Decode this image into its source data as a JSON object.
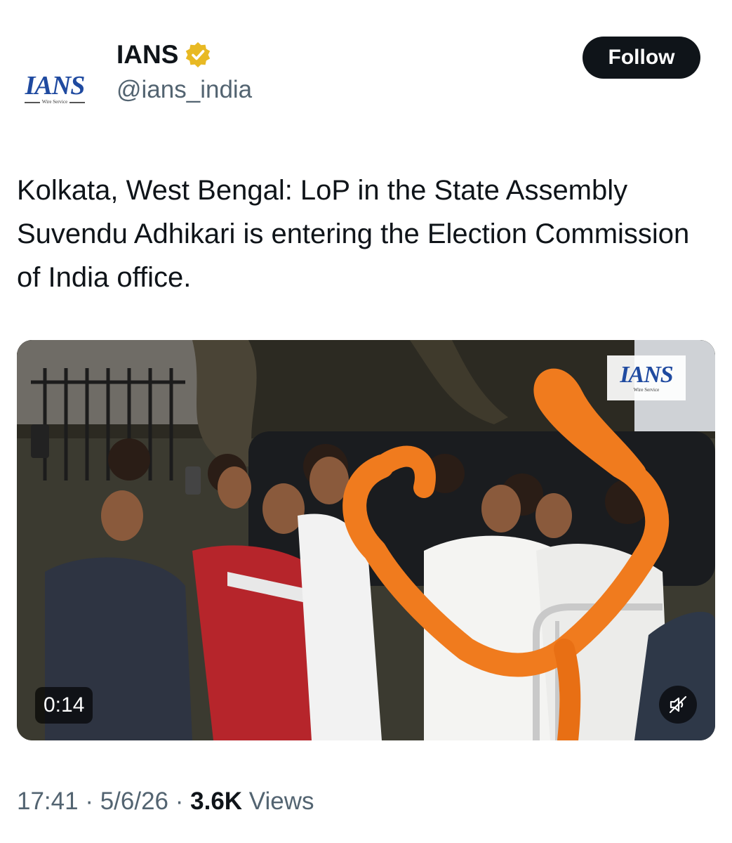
{
  "account": {
    "avatar_logo": "IANS",
    "avatar_sub": "Wire Service",
    "display_name": "IANS",
    "verified_icon": "verified-badge-gold",
    "handle": "@ians_india"
  },
  "actions": {
    "follow_label": "Follow"
  },
  "tweet": {
    "text": "Kolkata, West Bengal: LoP in the State Assembly Suvendu Adhikari is entering the Election Commission of India office."
  },
  "media": {
    "watermark_logo": "IANS",
    "watermark_sub": "Wire Service",
    "duration": "0:14",
    "mute_icon": "speaker-muted-icon"
  },
  "meta": {
    "time": "17:41",
    "separator": " · ",
    "date": "5/6/26",
    "views_count": "3.6K",
    "views_label": " Views"
  },
  "colors": {
    "text_primary": "#0f1419",
    "text_secondary": "#536471",
    "verified_gold": "#e8b923",
    "brand_blue": "#1f4aa0",
    "marigold": "#f07b1e"
  }
}
